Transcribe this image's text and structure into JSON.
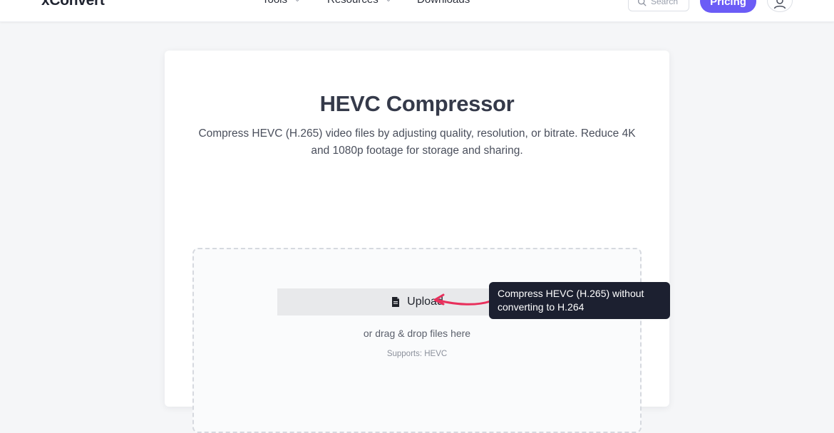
{
  "header": {
    "logo": "xConvert",
    "nav": [
      {
        "label": "Tools",
        "has_dropdown": true
      },
      {
        "label": "Resources",
        "has_dropdown": true
      },
      {
        "label": "Downloads",
        "has_dropdown": false
      }
    ],
    "search_label": "Search",
    "pricing_label": "Pricing"
  },
  "main": {
    "title": "HEVC Compressor",
    "description": "Compress HEVC (H.265) video files by adjusting quality, resolution, or bitrate. Reduce 4K and 1080p footage for storage and sharing.",
    "upload_label": "Upload",
    "drag_text": "or drag & drop files here",
    "supports_text": "Supports: HEVC"
  },
  "tooltip": {
    "text": "Compress HEVC (H.265) without converting to H.264"
  },
  "colors": {
    "accent": "#6b5cf6",
    "annotation_arrow": "#e8305c",
    "tooltip_bg": "#1c2030"
  },
  "icons": {
    "search": "search-icon",
    "user": "user-icon",
    "file": "file-icon",
    "chevron": "chevron-down-icon"
  }
}
